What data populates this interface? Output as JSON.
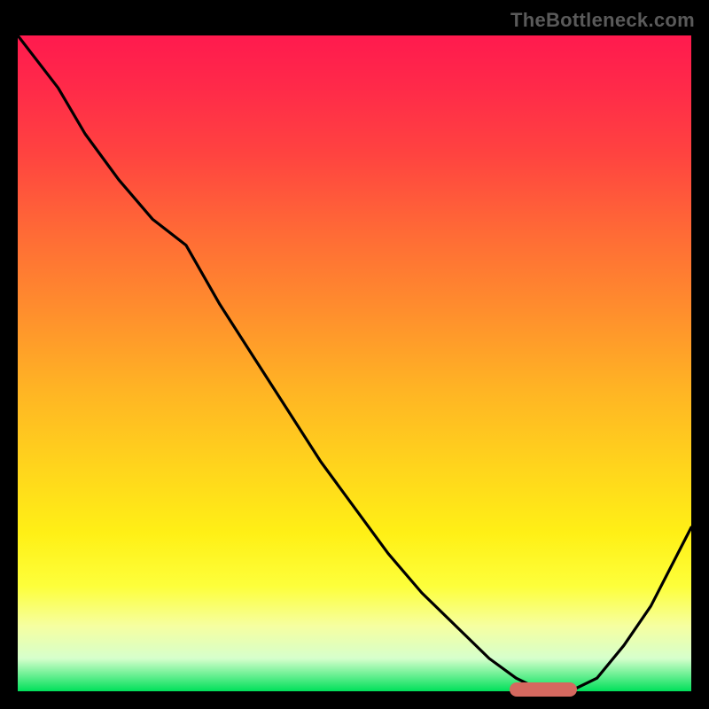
{
  "watermark": "TheBottleneck.com",
  "chart_data": {
    "type": "line",
    "title": "",
    "xlabel": "",
    "ylabel": "",
    "xlim": [
      0,
      100
    ],
    "ylim": [
      0,
      100
    ],
    "x": [
      0,
      6,
      10,
      15,
      20,
      25,
      30,
      35,
      40,
      45,
      50,
      55,
      60,
      65,
      70,
      74,
      78,
      82,
      86,
      90,
      94,
      97,
      100
    ],
    "values": [
      100,
      92,
      85,
      78,
      72,
      68,
      59,
      51,
      43,
      35,
      28,
      21,
      15,
      10,
      5,
      2,
      0,
      0,
      2,
      7,
      13,
      19,
      25
    ],
    "annotations": [
      {
        "name": "flat-zone",
        "x_start": 73,
        "x_end": 83,
        "y": 0
      }
    ],
    "gradient_stops": [
      {
        "pct": 0,
        "color": "#ff1a4e"
      },
      {
        "pct": 50,
        "color": "#ffb424"
      },
      {
        "pct": 85,
        "color": "#fdff3b"
      },
      {
        "pct": 100,
        "color": "#00e05a"
      }
    ]
  },
  "colors": {
    "curve": "#000000",
    "marker": "#d5685f",
    "background": "#000000"
  }
}
